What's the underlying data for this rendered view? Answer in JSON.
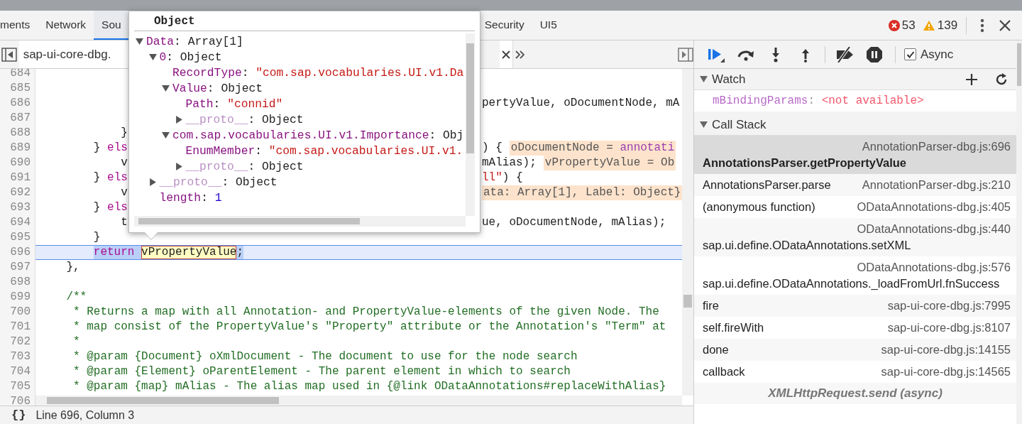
{
  "panel_tabs": {
    "left": [
      {
        "label": "ments",
        "selected": false
      },
      {
        "label": "Network",
        "selected": false
      },
      {
        "label": "Sou",
        "selected": true
      }
    ],
    "right": [
      {
        "label": "Security",
        "selected": false
      },
      {
        "label": "UI5",
        "selected": false
      }
    ]
  },
  "counts": {
    "errors": "53",
    "warnings": "139"
  },
  "editor": {
    "file_tab": "sap-ui-core-dbg.",
    "lines": [
      {
        "number": "684",
        "current": false
      },
      {
        "number": "685",
        "current": false
      },
      {
        "number": "686",
        "current": false,
        "right": [
          {
            "text": "pertyValue, oDocumentNode, mA",
            "kind": "plain"
          }
        ]
      },
      {
        "number": "687",
        "current": false
      },
      {
        "number": "688",
        "current": false,
        "left": [
          {
            "text": "            }",
            "kind": "plain"
          }
        ]
      },
      {
        "number": "689",
        "current": false,
        "left": [
          {
            "text": "        }",
            "kind": "plain"
          },
          {
            "text": " els",
            "kind": "keyword"
          }
        ],
        "right": [
          {
            "text": ") {",
            "kind": "plain"
          },
          {
            "kind": "chip",
            "parts": [
              {
                "text": "oDocumentNode = ",
                "kind": "plain"
              },
              {
                "text": "annotati",
                "kind": "call"
              }
            ]
          }
        ]
      },
      {
        "number": "690",
        "current": false,
        "left": [
          {
            "text": "            v",
            "kind": "plain"
          }
        ],
        "right": [
          {
            "text": "mAlias);",
            "kind": "plain"
          },
          {
            "kind": "chip",
            "parts": [
              {
                "text": "vPropertyValue = Ob",
                "kind": "plain"
              }
            ]
          }
        ]
      },
      {
        "number": "691",
        "current": false,
        "left": [
          {
            "text": "        }",
            "kind": "plain"
          },
          {
            "text": " els",
            "kind": "keyword"
          }
        ],
        "right": [
          {
            "text": "ll\"",
            "kind": "string"
          },
          {
            "text": ") {",
            "kind": "plain"
          }
        ]
      },
      {
        "number": "692",
        "current": false,
        "left": [
          {
            "text": "            v",
            "kind": "plain"
          }
        ],
        "right": [
          {
            "kind": "chip",
            "parts": [
              {
                "text": "ata: Array[1], Label: Object}",
                "kind": "plain"
              }
            ]
          }
        ]
      },
      {
        "number": "693",
        "current": false,
        "left": [
          {
            "text": "        }",
            "kind": "plain"
          },
          {
            "text": " els",
            "kind": "keyword"
          }
        ]
      },
      {
        "number": "694",
        "current": false,
        "left": [
          {
            "text": "            t",
            "kind": "plain"
          }
        ],
        "right": [
          {
            "text": "ue, oDocumentNode, mAlias);",
            "kind": "plain"
          }
        ]
      },
      {
        "number": "695",
        "current": false,
        "left": [
          {
            "text": "        }",
            "kind": "plain"
          }
        ]
      },
      {
        "number": "696",
        "current": true,
        "left": [
          {
            "text": "        return ",
            "kind": "keyword_sel"
          },
          {
            "text": "vPropertyValue",
            "kind": "token"
          },
          {
            "text": ";",
            "kind": "plain_sel"
          }
        ]
      },
      {
        "number": "697",
        "current": false,
        "left": [
          {
            "text": "    },",
            "kind": "plain"
          }
        ]
      },
      {
        "number": "698",
        "current": false
      },
      {
        "number": "699",
        "current": false,
        "left": [
          {
            "text": "    /**",
            "kind": "comment"
          }
        ]
      },
      {
        "number": "700",
        "current": false,
        "left": [
          {
            "text": "     * Returns a map with all Annotation- and PropertyValue-elements of the given Node. The",
            "kind": "comment"
          }
        ]
      },
      {
        "number": "701",
        "current": false,
        "left": [
          {
            "text": "     * map consist of the PropertyValue's \"Property\" attribute or the Annotation's \"Term\" at",
            "kind": "comment"
          }
        ]
      },
      {
        "number": "702",
        "current": false,
        "left": [
          {
            "text": "     *",
            "kind": "comment"
          }
        ]
      },
      {
        "number": "703",
        "current": false,
        "left": [
          {
            "text": "     * @param {Document} oXmlDocument - The document to use for the node search",
            "kind": "comment"
          }
        ]
      },
      {
        "number": "704",
        "current": false,
        "left": [
          {
            "text": "     * @param {Element} oParentElement - The parent element in which to search",
            "kind": "comment"
          }
        ]
      },
      {
        "number": "705",
        "current": false,
        "left": [
          {
            "text": "     * @param {map} mAlias - The alias map used in {@link ODataAnnotations#replaceWithAlias}",
            "kind": "comment"
          }
        ]
      },
      {
        "number": "706",
        "current": false
      }
    ],
    "format_label": "{}",
    "cursor_position": "Line 696, Column 3"
  },
  "popover": {
    "title": "Object",
    "tree": [
      {
        "key": "Data",
        "sep": ":",
        "value": " Array[1]",
        "kind": "object",
        "inherited": false,
        "expanded": true,
        "children": [
          {
            "key": "0",
            "sep": ":",
            "value": " Object",
            "kind": "object",
            "inherited": false,
            "expanded": true,
            "children": [
              {
                "key": "RecordType",
                "sep": ":",
                "value": " \"com.sap.vocabularies.UI.v1.Da",
                "kind": "string",
                "inherited": false
              },
              {
                "key": "Value",
                "sep": ":",
                "value": " Object",
                "kind": "object",
                "inherited": false,
                "expanded": true,
                "children": [
                  {
                    "key": "Path",
                    "sep": ":",
                    "value": " \"connid\"",
                    "kind": "string",
                    "inherited": false
                  },
                  {
                    "key": "__proto__",
                    "sep": ":",
                    "value": " Object",
                    "kind": "object",
                    "inherited": true,
                    "expanded": false
                  }
                ]
              },
              {
                "key": "com.sap.vocabularies.UI.v1.Importance",
                "sep": ":",
                "value": " Obj",
                "kind": "object",
                "inherited": false,
                "expanded": true,
                "children": [
                  {
                    "key": "EnumMember",
                    "sep": ":",
                    "value": " \"com.sap.vocabularies.UI.v1.",
                    "kind": "string",
                    "inherited": false
                  },
                  {
                    "key": "__proto__",
                    "sep": ":",
                    "value": " Object",
                    "kind": "object",
                    "inherited": true,
                    "expanded": false
                  }
                ]
              }
            ]
          },
          {
            "key": "__proto__",
            "sep": ":",
            "value": " Object",
            "kind": "object",
            "inherited": true,
            "expanded": false
          },
          {
            "key": "length",
            "sep": ":",
            "value": " 1",
            "kind": "number",
            "inherited": false
          }
        ]
      }
    ]
  },
  "debugger": {
    "async": {
      "label": "Async",
      "checked": true
    },
    "watch": {
      "title": "Watch",
      "expanded": true,
      "items": [
        {
          "name": "mBindingParams",
          "sep": ":",
          "value": " <not available>"
        }
      ]
    },
    "call_stack": {
      "title": "Call Stack",
      "expanded": true,
      "frames": [
        {
          "function": "AnnotationsParser.getPropertyValue",
          "location": "AnnotationParser-dbg.js:696",
          "selected": true
        },
        {
          "function": "AnnotationsParser.parse",
          "location": "AnnotationParser-dbg.js:210",
          "selected": false
        },
        {
          "function": "(anonymous function)",
          "location": "ODataAnnotations-dbg.js:405",
          "selected": false
        },
        {
          "function": "sap.ui.define.ODataAnnotations.setXML",
          "location": "ODataAnnotations-dbg.js:440",
          "selected": false
        },
        {
          "function": "sap.ui.define.ODataAnnotations._loadFromUrl.fnSuccess",
          "location": "ODataAnnotations-dbg.js:576",
          "selected": false
        },
        {
          "function": "fire",
          "location": "sap-ui-core-dbg.js:7995",
          "selected": false
        },
        {
          "function": "self.fireWith",
          "location": "sap-ui-core-dbg.js:8107",
          "selected": false
        },
        {
          "function": "done",
          "location": "sap-ui-core-dbg.js:14155",
          "selected": false
        },
        {
          "function": "callback",
          "location": "sap-ui-core-dbg.js:14565",
          "selected": false
        }
      ],
      "async_label": "XMLHttpRequest.send (async)"
    }
  }
}
